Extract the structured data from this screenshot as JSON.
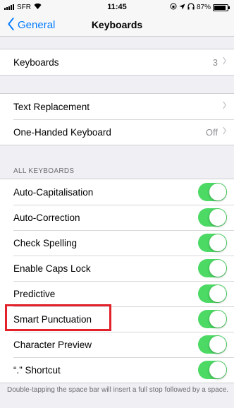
{
  "status_bar": {
    "carrier": "SFR",
    "time": "11:45",
    "battery_text": "87%",
    "battery_level": 0.87
  },
  "nav": {
    "back_label": "General",
    "title": "Keyboards"
  },
  "group_keyboards": {
    "label": "Keyboards",
    "value": "3"
  },
  "group_text": {
    "items": [
      {
        "label": "Text Replacement",
        "value": ""
      },
      {
        "label": "One-Handed Keyboard",
        "value": "Off"
      }
    ]
  },
  "all_keyboards": {
    "header": "ALL KEYBOARDS",
    "items": [
      {
        "label": "Auto-Capitalisation",
        "on": true
      },
      {
        "label": "Auto-Correction",
        "on": true
      },
      {
        "label": "Check Spelling",
        "on": true
      },
      {
        "label": "Enable Caps Lock",
        "on": true
      },
      {
        "label": "Predictive",
        "on": true
      },
      {
        "label": "Smart Punctuation",
        "on": true
      },
      {
        "label": "Character Preview",
        "on": true
      },
      {
        "label": "“.” Shortcut",
        "on": true
      }
    ],
    "footer": "Double-tapping the space bar will insert a full stop followed by a space."
  },
  "colors": {
    "toggle_on": "#4cd964",
    "accent": "#007aff",
    "highlight": "#e2222a"
  }
}
